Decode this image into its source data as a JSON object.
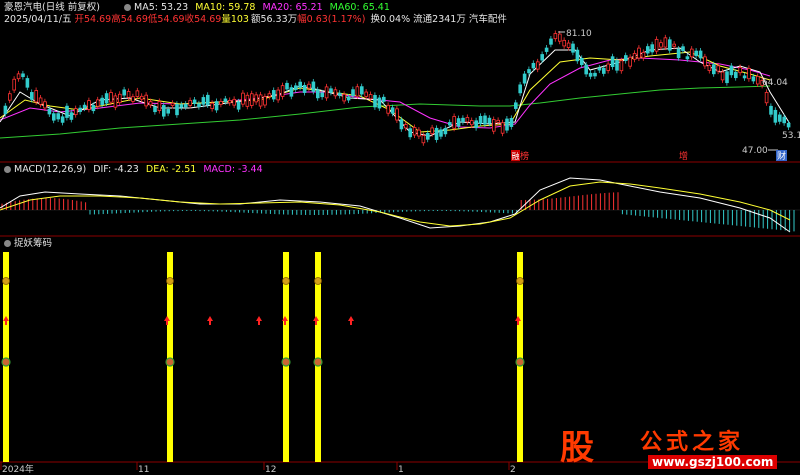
{
  "header": {
    "title": "豪恩汽电(日线 前复权)",
    "ma5_label": "MA5: 53.23",
    "ma10_label": "MA10: 59.78",
    "ma20_label": "MA20: 65.21",
    "ma60_label": "MA60: 65.41"
  },
  "info_bar": {
    "date": "2025/04/11/五",
    "open": "开54.69",
    "high": "高54.69",
    "low": "低54.69",
    "close": "收54.69",
    "volume": "量103",
    "amount": "额56.33万",
    "change": "幅0.63(1.17%)",
    "turnover": "换0.04%",
    "float": "流通2341万",
    "sector": "汽车配件"
  },
  "price_panel": {
    "high_label": "81.10",
    "low_label": "47.00",
    "right_label_1": "64.04",
    "right_label_2": "53.1",
    "marker_1": "融",
    "marker_2": "榜",
    "marker_3": "增",
    "marker_4": "财"
  },
  "macd_panel": {
    "title": "MACD(12,26,9)",
    "dif": "DIF: -4.23",
    "dea": "DEA: -2.51",
    "macd": "MACD: -3.44"
  },
  "signal_panel": {
    "title": "捉妖筹码"
  },
  "x_axis": {
    "labels": [
      "2024年",
      "11",
      "12",
      "1",
      "2"
    ]
  },
  "watermark": {
    "logo_char": "股",
    "site_name": "公式之家",
    "url": "www.gszj100.com"
  },
  "colors": {
    "up": "#ff3333",
    "down": "#33cccc",
    "ma5": "#ffffff",
    "ma10": "#ffff33",
    "ma20": "#ff33ff",
    "ma60": "#33cc33",
    "signal_bar": "#ffff00"
  }
}
